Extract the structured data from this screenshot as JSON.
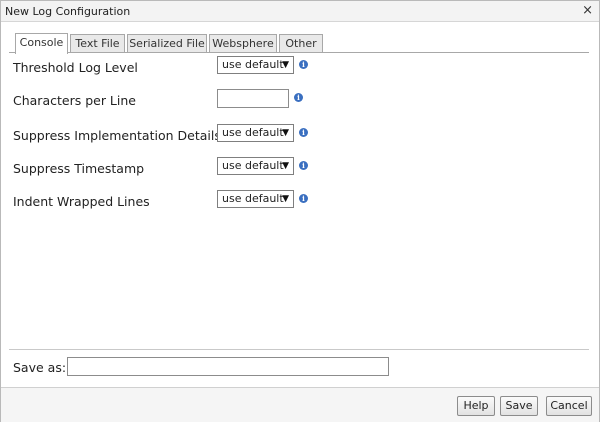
{
  "window": {
    "title": "New Log Configuration",
    "close_glyph": "×"
  },
  "tabs": [
    {
      "label": "Console",
      "active": true
    },
    {
      "label": "Text File",
      "active": false
    },
    {
      "label": "Serialized File",
      "active": false
    },
    {
      "label": "Websphere",
      "active": false
    },
    {
      "label": "Other",
      "active": false
    }
  ],
  "form": {
    "threshold_log_level": {
      "label": "Threshold Log Level",
      "value": "use default"
    },
    "characters_per_line": {
      "label": "Characters per Line",
      "value": ""
    },
    "suppress_implementation_details": {
      "label": "Suppress Implementation Details",
      "value": "use default"
    },
    "suppress_timestamp": {
      "label": "Suppress Timestamp",
      "value": "use default"
    },
    "indent_wrapped_lines": {
      "label": "Indent Wrapped Lines",
      "value": "use default"
    },
    "dropdown_arrow": "▼",
    "info_glyph": "i"
  },
  "save_as": {
    "label": "Save as:",
    "value": ""
  },
  "buttons": {
    "help": "Help",
    "save": "Save",
    "cancel": "Cancel"
  },
  "icons": {
    "close": "close-icon",
    "info": "info-icon",
    "dropdown": "dropdown-arrow-icon"
  },
  "colors": {
    "info_icon": "#3a6fc0",
    "titlebar_bg": "#f3f3f3",
    "tab_inactive_bg": "#e9e9e9"
  }
}
